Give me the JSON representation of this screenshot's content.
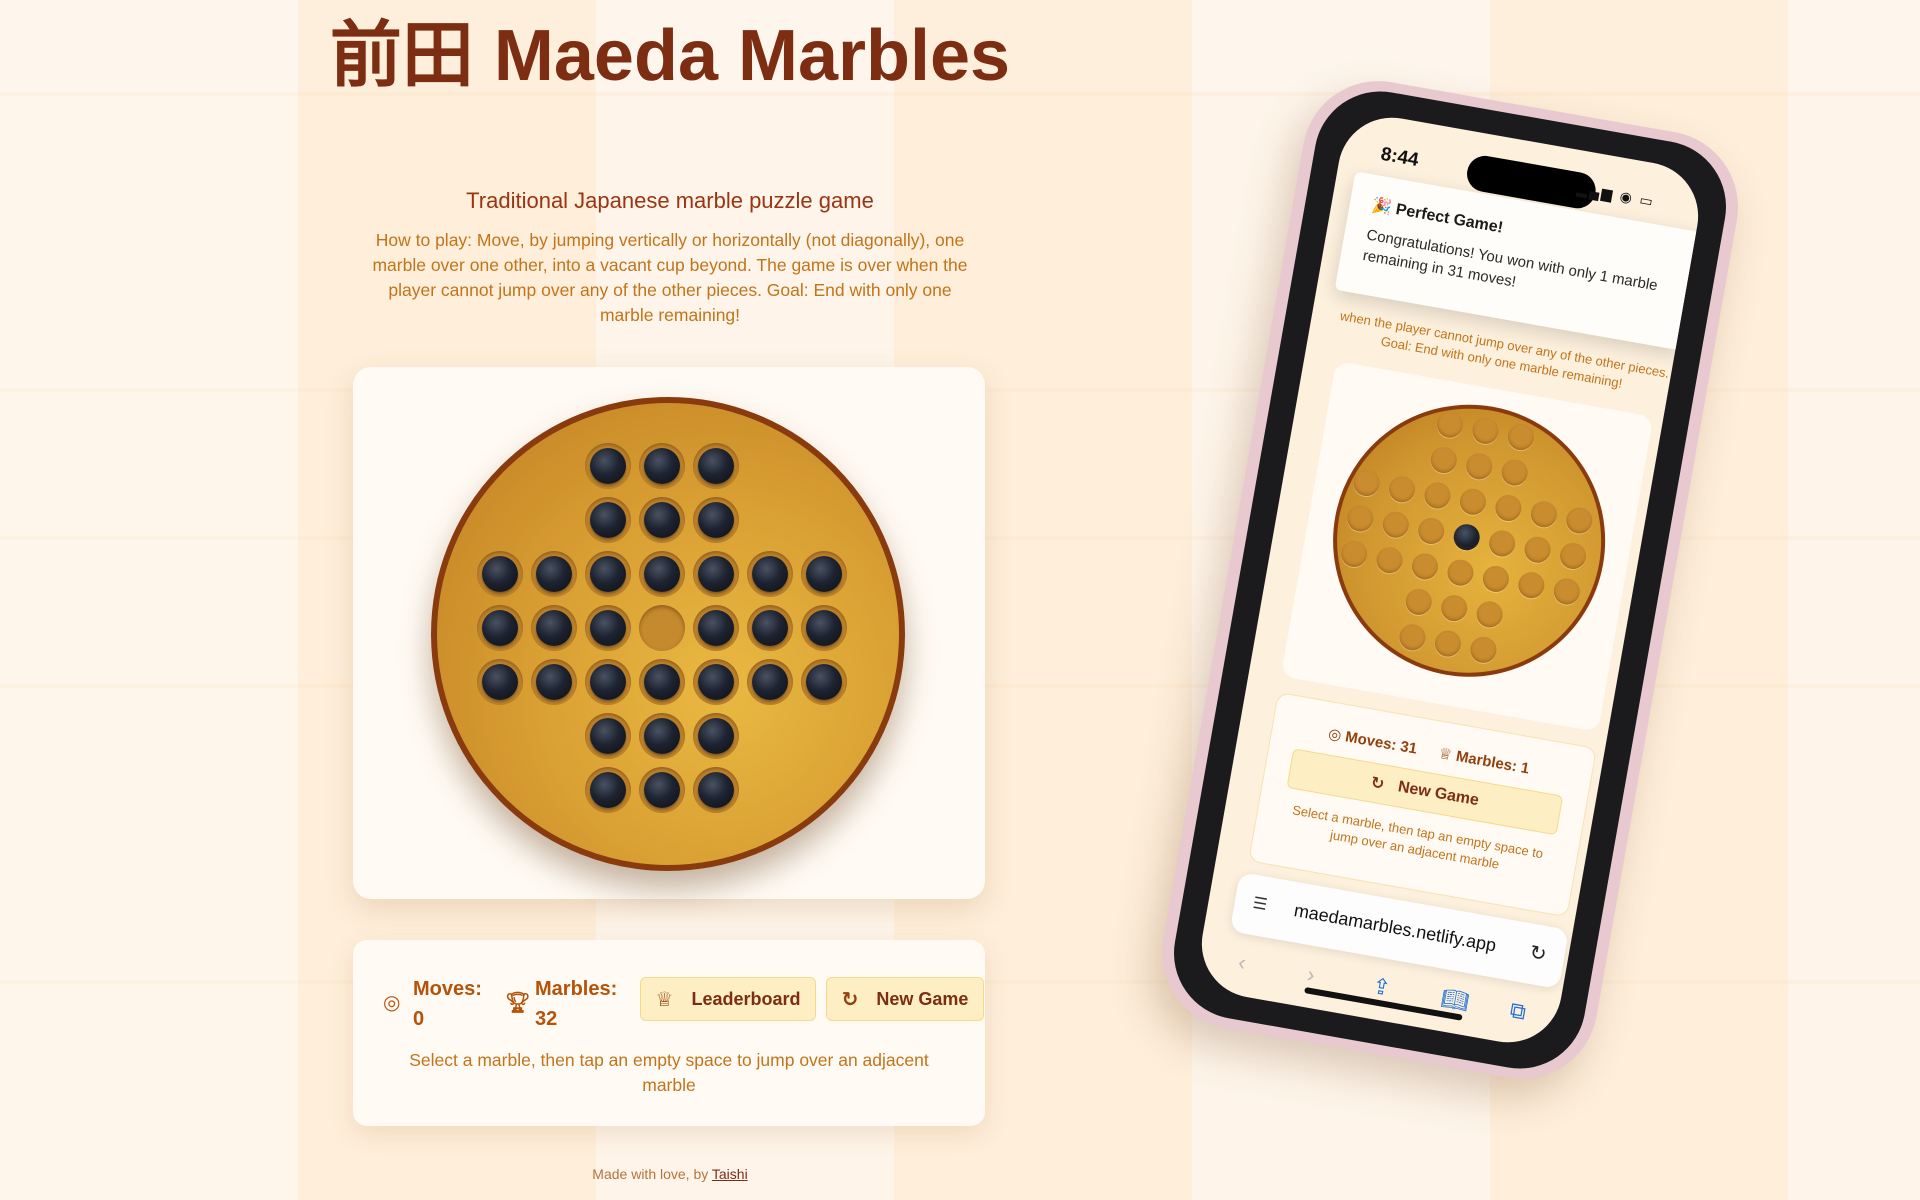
{
  "app": {
    "title": "前田 Maeda Marbles",
    "subtitle": "Traditional Japanese marble puzzle game",
    "how_to_play": "How to play: Move, by jumping vertically or horizontally (not diagonally), one marble over one other, into a vacant cup beyond. The game is over when the player cannot jump over any of the other pieces. Goal: End with only one marble remaining!"
  },
  "stats": {
    "moves_label": "Moves:",
    "moves_value": "0",
    "marbles_label": "Marbles:",
    "marbles_value": "32"
  },
  "buttons": {
    "leaderboard": "Leaderboard",
    "new_game": "New Game"
  },
  "hint": "Select a marble, then tap an empty space to jump over an adjacent marble",
  "footer": {
    "prefix": "Made with love, by",
    "author": "Taishi"
  },
  "icons": {
    "moves": "target-icon",
    "marbles": "trophy-icon",
    "leaderboard": "trophy-icon",
    "new_game": "refresh-icon"
  },
  "colors": {
    "title": "#7c2d12",
    "accent": "#b45309",
    "button_bg": "#fdefc3",
    "board_rim": "#8a3b0e",
    "board_wood": "#d9a033"
  },
  "mobile": {
    "time": "8:44",
    "toast": {
      "title": "🎉 Perfect Game!",
      "body": "Congratulations! You won with only 1 marble remaining in 31 moves!"
    },
    "howto_fragment": "when the player cannot jump over any of the other pieces. Goal: End with only one marble remaining!",
    "moves": "Moves: 31",
    "marbles": "Marbles: 1",
    "new_game": "New Game",
    "hint": "Select a marble, then tap an empty space to jump over an adjacent marble",
    "url": "maedamarbles.netlify.app"
  }
}
